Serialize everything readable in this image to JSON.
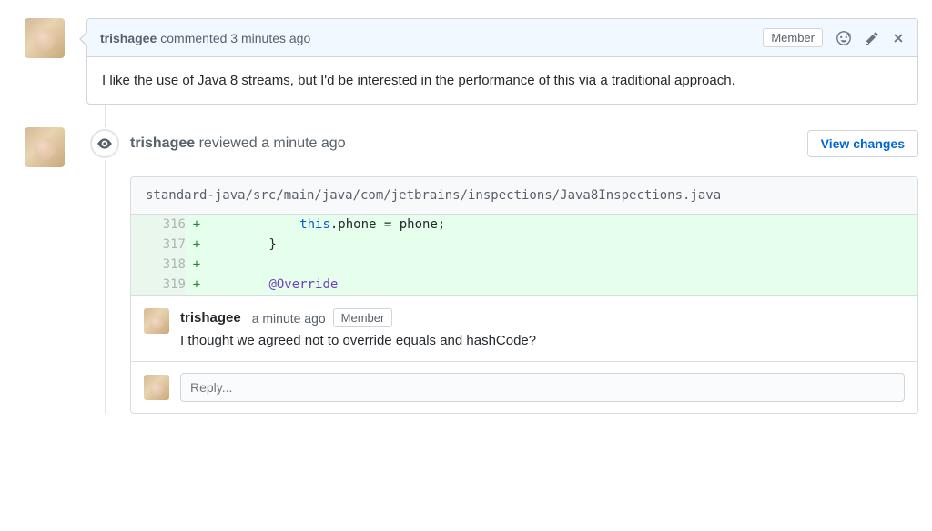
{
  "comment1": {
    "author": "trishagee",
    "action": "commented",
    "time": "3 minutes ago",
    "badge": "Member",
    "body": "I like the use of Java 8 streams, but I'd be interested in the performance of this via a traditional approach."
  },
  "review": {
    "author": "trishagee",
    "action": "reviewed",
    "time": "a minute ago",
    "view_changes": "View changes",
    "file_path": "standard-java/src/main/java/com/jetbrains/inspections/Java8Inspections.java",
    "diff": [
      {
        "num": "316",
        "mark": "+",
        "prefix": "            ",
        "kw": "this",
        "rest": ".phone = phone;"
      },
      {
        "num": "317",
        "mark": "+",
        "prefix": "        ",
        "kw": "",
        "rest": "}"
      },
      {
        "num": "318",
        "mark": "+",
        "prefix": "",
        "kw": "",
        "rest": ""
      },
      {
        "num": "319",
        "mark": "+",
        "prefix": "        ",
        "kw": "@Override",
        "rest": ""
      }
    ],
    "inline": {
      "author": "trishagee",
      "time": "a minute ago",
      "badge": "Member",
      "body": "I thought we agreed not to override equals and hashCode?"
    },
    "reply_placeholder": "Reply..."
  }
}
